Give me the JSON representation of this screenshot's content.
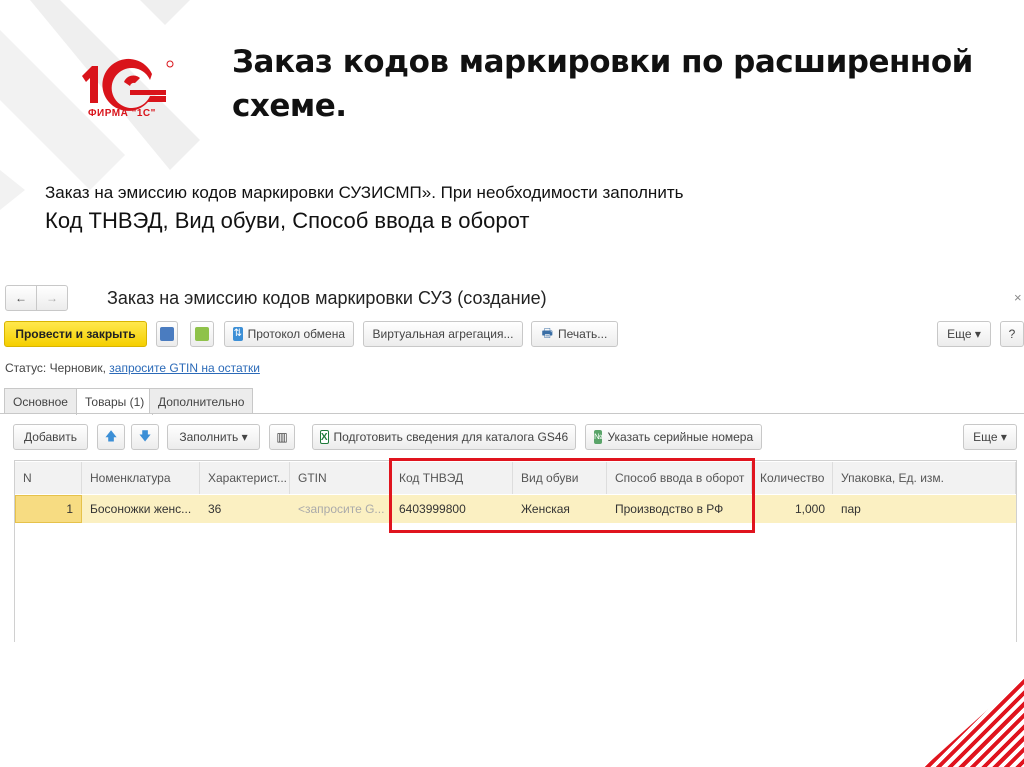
{
  "slide": {
    "title_line1": "Заказ кодов маркировки по расширенной",
    "title_line2": "схеме.",
    "subtitle_line1": "Заказ на эмиссию кодов маркировки СУЗИСМП». При необходимости заполнить",
    "subtitle_line2": "Код ТНВЭД, Вид обуви, Способ ввода в оборот",
    "logo_text": "ФИРМА \"1С\""
  },
  "window": {
    "title": "Заказ на эмиссию кодов маркировки СУЗ (создание)",
    "back": "←",
    "forward": "→",
    "close": "×"
  },
  "toolbar": {
    "post_close": "Провести и закрыть",
    "exchange_log": "Протокол обмена",
    "virtual_agg": "Виртуальная агрегация...",
    "print": "Печать...",
    "more": "Еще ▾",
    "help": "?"
  },
  "status": {
    "label": "Статус:",
    "value": "Черновик,",
    "link": "запросите GTIN на остатки"
  },
  "tabs": [
    "Основное",
    "Товары (1)",
    "Дополнительно"
  ],
  "table_toolbar": {
    "add": "Добавить",
    "fill": "Заполнить ▾",
    "prepare": "Подготовить сведения для каталога GS46",
    "serials": "Указать серийные номера",
    "more": "Еще ▾"
  },
  "table": {
    "headers": [
      "N",
      "Номенклатура",
      "Характерист...",
      "GTIN",
      "Код ТНВЭД",
      "Вид обуви",
      "Способ ввода в оборот",
      "Количество",
      "Упаковка, Ед. изм."
    ],
    "rows": [
      [
        "1",
        "Босоножки женс...",
        "36",
        "<запросите G...",
        "6403999800",
        "Женская",
        "Производство в РФ",
        "1,000",
        "пар"
      ]
    ]
  },
  "colors": {
    "accent": "#e0141e",
    "yellow": "#f5cf00",
    "row": "#fbf0c2"
  }
}
